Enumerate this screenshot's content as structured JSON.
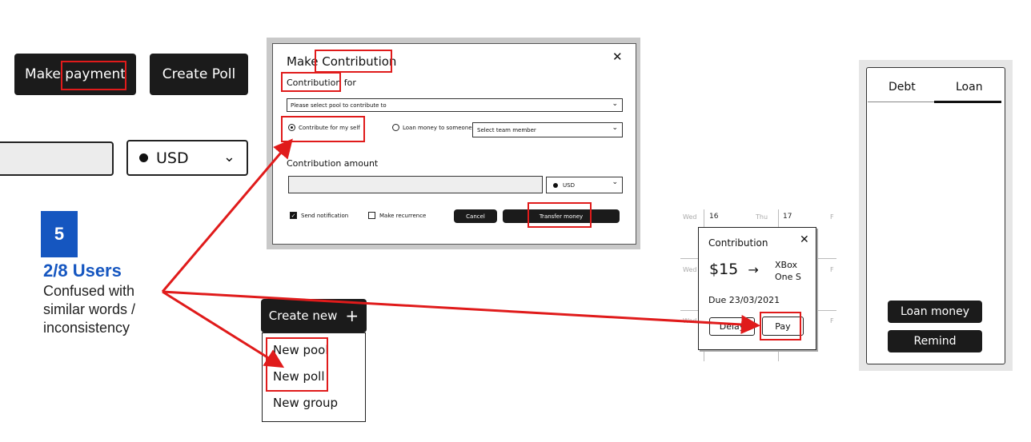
{
  "finding": {
    "number": "5",
    "users": "2/8 Users",
    "description": "Confused with similar words / inconsistency"
  },
  "sketch_left": {
    "make_payment": "Make payment",
    "create_poll": "Create Poll",
    "currency": "USD"
  },
  "modal": {
    "title": "Make Contribution",
    "contribution_for": "Contribution for",
    "pool_placeholder": "Please select pool to contribute to",
    "radio_self": "Contribute for my self",
    "radio_loan": "Loan money to someone",
    "member_placeholder": "Select team member",
    "amount_label": "Contribution amount",
    "currency": "USD",
    "send_notification": "Send notification",
    "make_recurrence": "Make recurrence",
    "cancel": "Cancel",
    "transfer": "Transfer money"
  },
  "create_menu": {
    "button": "Create new",
    "items": [
      "New pool",
      "New poll",
      "New group"
    ]
  },
  "calendar": {
    "days": [
      "Wed",
      "16",
      "Thu",
      "17",
      "Wed",
      "Wed",
      "F",
      "F",
      "F"
    ],
    "popup_title": "Contribution",
    "amount": "$15",
    "arrow": "→",
    "item_line1": "XBox",
    "item_line2": "One S",
    "due": "Due 23/03/2021",
    "delay": "Delay",
    "pay": "Pay"
  },
  "panel": {
    "tabs": [
      "Debt",
      "Loan"
    ],
    "loan_money": "Loan money",
    "remind": "Remind"
  },
  "colors": {
    "accent_blue": "#1556c0",
    "highlight_red": "#e01b1b",
    "button_dark": "#1b1b1b"
  }
}
